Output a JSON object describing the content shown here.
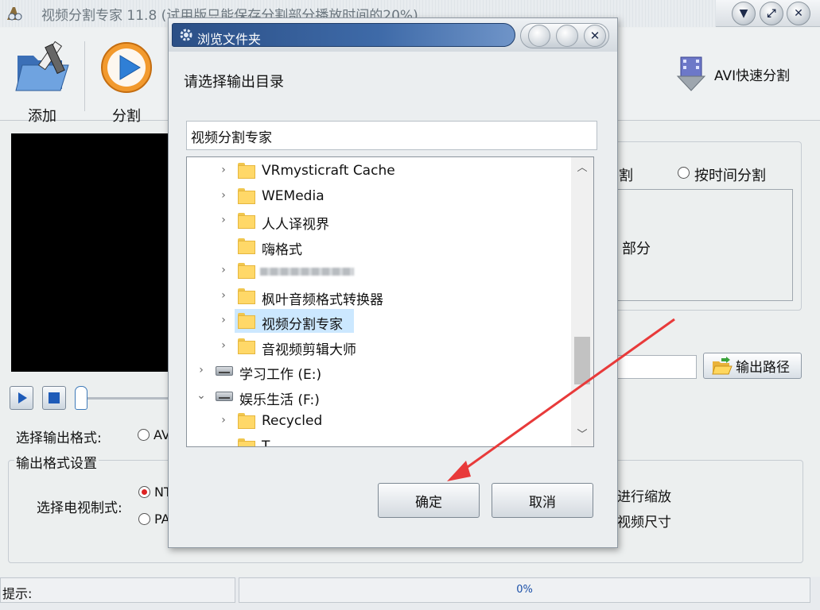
{
  "app": {
    "title": "视频分割专家 11.8 (试用版只能保存分割部分播放时间的20%)"
  },
  "toolbar": {
    "add_label": "添加",
    "split_label": "分割",
    "avi_split_label": "AVI快速分割"
  },
  "split_mode": {
    "partial_label_1": "割",
    "time_split_label": "按时间分割",
    "partial_label_2": "部分"
  },
  "output_path": {
    "button_label": "输出路径"
  },
  "format": {
    "select_label": "选择输出格式:",
    "option_partial": "AV",
    "settings_group_title": "输出格式设置",
    "tv_system_label": "选择电视制式:",
    "ntsc_partial": "NT",
    "pal_partial": "PA",
    "scale_partial": "进行缩放",
    "video_size_partial": "视频尺寸"
  },
  "status": {
    "hint_label": "提示:",
    "progress": "0%"
  },
  "dialog": {
    "title": "浏览文件夹",
    "prompt": "请选择输出目录",
    "path_value": "视频分割专家",
    "ok_label": "确定",
    "cancel_label": "取消",
    "tree": [
      {
        "label": "VRmysticraft Cache",
        "type": "folder",
        "level": 2,
        "expand": "collapsed"
      },
      {
        "label": "WEMedia",
        "type": "folder",
        "level": 2,
        "expand": "collapsed"
      },
      {
        "label": "人人译视界",
        "type": "folder",
        "level": 2,
        "expand": "collapsed"
      },
      {
        "label": "嗨格式",
        "type": "folder",
        "level": 2,
        "expand": "none"
      },
      {
        "label": "",
        "type": "folder-blurred",
        "level": 2,
        "expand": "collapsed"
      },
      {
        "label": "枫叶音频格式转换器",
        "type": "folder",
        "level": 2,
        "expand": "collapsed"
      },
      {
        "label": "视频分割专家",
        "type": "folder",
        "level": 2,
        "expand": "collapsed",
        "selected": true
      },
      {
        "label": "音视频剪辑大师",
        "type": "folder",
        "level": 2,
        "expand": "collapsed"
      },
      {
        "label": "学习工作 (E:)",
        "type": "drive",
        "level": 1,
        "expand": "collapsed"
      },
      {
        "label": "娱乐生活 (F:)",
        "type": "drive",
        "level": 1,
        "expand": "expanded"
      },
      {
        "label": "Recycled",
        "type": "folder",
        "level": 2,
        "expand": "collapsed"
      },
      {
        "label": "T",
        "type": "folder",
        "level": 2,
        "expand": "none"
      }
    ]
  },
  "colors": {
    "annotation_arrow": "#e83a3a",
    "selection": "#cce8ff",
    "dialog_title_ribbon": "#2b4f86"
  }
}
